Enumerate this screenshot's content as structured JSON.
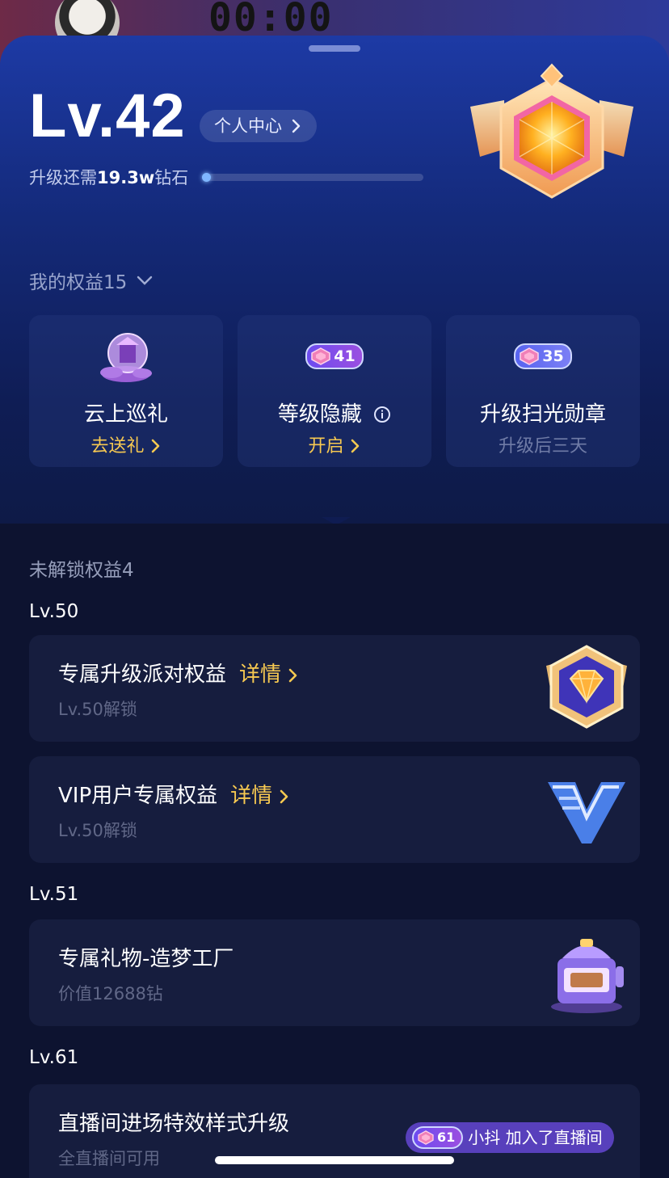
{
  "backdrop": {
    "timer": "00:00"
  },
  "header": {
    "level": "Lv.42",
    "personal_center": "个人中心",
    "upgrade_prefix": "升级还需",
    "upgrade_amount": "19.3w",
    "upgrade_suffix": "钻石",
    "progress_fraction": 0.02
  },
  "my_benefits": {
    "label": "我的权益15",
    "cards": [
      {
        "title": "云上巡礼",
        "action": "去送礼",
        "icon": "cloud-palace-icon"
      },
      {
        "title": "等级隐藏",
        "action": "开启",
        "badge_level": "41",
        "icon": "info-icon"
      },
      {
        "title": "升级扫光勋章",
        "action": "升级后三天",
        "badge_level": "35"
      }
    ]
  },
  "locked": {
    "label": "未解锁权益4",
    "groups": [
      {
        "level": "Lv.50",
        "items": [
          {
            "title": "专属升级派对权益",
            "detail": "详情",
            "sub": "Lv.50解锁",
            "icon": "diamond-badge-icon"
          },
          {
            "title": "VIP用户专属权益",
            "detail": "详情",
            "sub": "Lv.50解锁",
            "icon": "vip-v-icon"
          }
        ]
      },
      {
        "level": "Lv.51",
        "items": [
          {
            "title": "专属礼物-造梦工厂",
            "sub": "价值12688钻",
            "icon": "dream-factory-icon"
          }
        ]
      },
      {
        "level": "Lv.61",
        "items": [
          {
            "title": "直播间进场特效样式升级",
            "sub": "全直播间可用"
          }
        ]
      }
    ]
  },
  "toast": {
    "level": "61",
    "text": "小抖 加入了直播间"
  },
  "colors": {
    "accent_gold": "#f7c951",
    "sheet_top": "#1d3aa5",
    "sheet_bottom": "#0d1638"
  }
}
